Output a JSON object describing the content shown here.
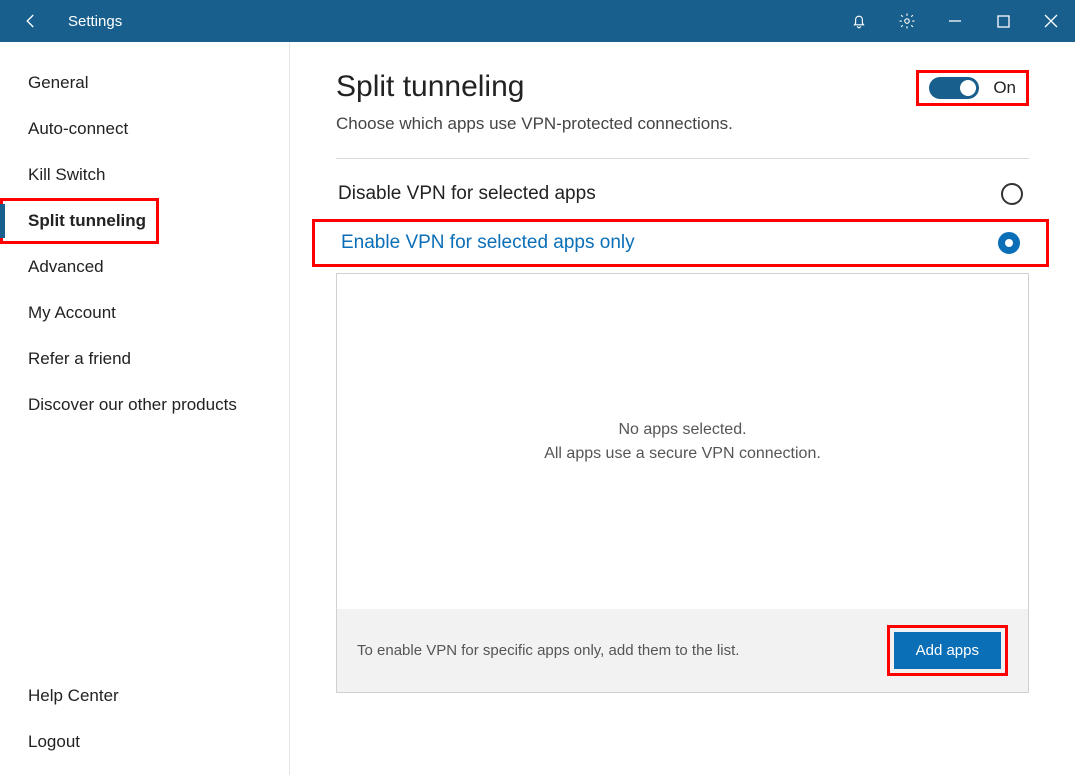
{
  "window": {
    "title": "Settings"
  },
  "sidebar": {
    "items": [
      {
        "label": "General"
      },
      {
        "label": "Auto-connect"
      },
      {
        "label": "Kill Switch"
      },
      {
        "label": "Split tunneling"
      },
      {
        "label": "Advanced"
      },
      {
        "label": "My Account"
      },
      {
        "label": "Refer a friend"
      },
      {
        "label": "Discover our other products"
      }
    ],
    "bottom": [
      {
        "label": "Help Center"
      },
      {
        "label": "Logout"
      }
    ],
    "active_index": 3
  },
  "main": {
    "title": "Split tunneling",
    "subtitle": "Choose which apps use VPN-protected connections.",
    "toggle": {
      "on_label": "On",
      "state": true
    },
    "options": [
      {
        "label": "Disable VPN for selected apps",
        "selected": false
      },
      {
        "label": "Enable VPN for selected apps only",
        "selected": true
      }
    ],
    "apps_box": {
      "empty_line1": "No apps selected.",
      "empty_line2": "All apps use a secure VPN connection.",
      "footer_text": "To enable VPN for specific apps only, add them to the list.",
      "add_button": "Add apps"
    }
  },
  "colors": {
    "accent": "#185f8d",
    "link": "#0b6fb8",
    "highlight": "#ff0000"
  }
}
